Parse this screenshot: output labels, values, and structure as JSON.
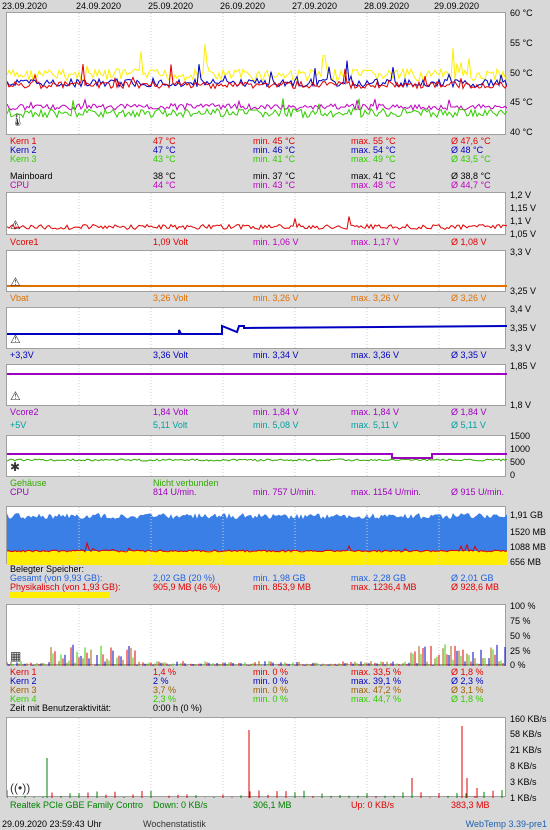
{
  "dates": [
    "23.09.2020",
    "24.09.2020",
    "25.09.2020",
    "26.09.2020",
    "27.09.2020",
    "28.09.2020",
    "29.09.2020"
  ],
  "temp": {
    "y_labels": [
      "60 °C",
      "55 °C",
      "50 °C",
      "45 °C",
      "40 °C"
    ],
    "rows": [
      {
        "name": "Kern 1",
        "cur": "47 °C",
        "min": "min. 45 °C",
        "max": "max. 55 °C",
        "avg": "Ø 47,6 °C",
        "color": "#e00000"
      },
      {
        "name": "Kern 2",
        "cur": "47 °C",
        "min": "min. 46 °C",
        "max": "max. 54 °C",
        "avg": "Ø 48 °C",
        "color": "#0000c0"
      },
      {
        "name": "Kern 3",
        "cur": "43 °C",
        "min": "min. 41 °C",
        "max": "max. 49 °C",
        "avg": "Ø 43,5 °C",
        "color": "#33cc00"
      },
      {
        "name": "Mainboard",
        "cur": "38 °C",
        "min": "min. 37 °C",
        "max": "max. 41 °C",
        "avg": "Ø 38,8 °C",
        "color": "#000000"
      },
      {
        "name": "CPU",
        "cur": "44 °C",
        "min": "min. 43 °C",
        "max": "max. 48 °C",
        "avg": "Ø 44,7 °C",
        "color": "#c000c0"
      }
    ]
  },
  "vcore": {
    "y_labels": [
      "1,2 V",
      "1,15 V",
      "1,1 V",
      "1,05 V"
    ],
    "row": {
      "name": "Vcore1",
      "cur": "1,09 Volt",
      "min": "min. 1,06 V",
      "max": "max. 1,17 V",
      "avg": "Ø 1,08 V",
      "color": "#e00000"
    }
  },
  "vbat": {
    "y_labels": [
      "3,3 V",
      "3,25 V"
    ],
    "row": {
      "name": "Vbat",
      "cur": "3,26 Volt",
      "min": "min. 3,26 V",
      "max": "max. 3,26 V",
      "avg": "Ø 3,26 V",
      "color": "#e07000"
    }
  },
  "v33": {
    "y_labels": [
      "3,4 V",
      "3,35 V",
      "3,3 V"
    ],
    "row": {
      "name": "+3,3V",
      "cur": "3,36 Volt",
      "min": "min. 3,34 V",
      "max": "max. 3,36 V",
      "avg": "Ø 3,35 V",
      "color": "#0000c0"
    }
  },
  "vcore2": {
    "y_labels": [
      "1,85 V",
      "1,8 V"
    ],
    "rows": [
      {
        "name": "Vcore2",
        "cur": "1,84 Volt",
        "min": "min. 1,84 V",
        "max": "max. 1,84 V",
        "avg": "Ø 1,84 V",
        "color": "#a000c0"
      },
      {
        "name": "+5V",
        "cur": "5,11 Volt",
        "min": "min. 5,08 V",
        "max": "max. 5,11 V",
        "avg": "Ø 5,11 V",
        "color": "#00a0a0"
      }
    ]
  },
  "fan": {
    "y_labels": [
      "1500",
      "1000",
      "500",
      "0"
    ],
    "rows": [
      {
        "name": "Gehäuse",
        "cur": "Nicht verbunden",
        "min": "",
        "max": "",
        "avg": "",
        "color": "#33aa00"
      },
      {
        "name": "CPU",
        "cur": "814 U/min.",
        "min": "min. 757 U/min.",
        "max": "max. 1154 U/min.",
        "avg": "Ø 915 U/min.",
        "color": "#a000c0"
      }
    ]
  },
  "mem": {
    "y_labels": [
      "1,91 GB",
      "1520 MB",
      "1088 MB",
      "656 MB"
    ],
    "title": "Belegter Speicher:",
    "rows": [
      {
        "name": "Gesamt (von 9,93 GB):",
        "cur": "2,02 GB (20 %)",
        "min": "min. 1,98 GB",
        "max": "max. 2,28 GB",
        "avg": "Ø 2,01 GB",
        "color": "#2060e0"
      },
      {
        "name": "Physikalisch (von 1,93 GB):",
        "cur": "905,9 MB (46 %)",
        "min": "min. 853,9 MB",
        "max": "max. 1236,4 MB",
        "avg": "Ø 928,6 MB",
        "color": "#e00000"
      }
    ]
  },
  "cpu": {
    "y_labels": [
      "100 %",
      "75 %",
      "50 %",
      "25 %",
      "0 %"
    ],
    "rows": [
      {
        "name": "Kern 1",
        "cur": "1,4 %",
        "min": "min. 0 %",
        "max": "max. 33,5 %",
        "avg": "Ø 1,8 %",
        "color": "#e00000"
      },
      {
        "name": "Kern 2",
        "cur": "2 %",
        "min": "min. 0 %",
        "max": "max. 39,1 %",
        "avg": "Ø 2,3 %",
        "color": "#0000c0"
      },
      {
        "name": "Kern 3",
        "cur": "3,7 %",
        "min": "min. 0 %",
        "max": "max. 47,2 %",
        "avg": "Ø 3,1 %",
        "color": "#a06000"
      },
      {
        "name": "Kern 4",
        "cur": "2,3 %",
        "min": "min. 0 %",
        "max": "max. 44,7 %",
        "avg": "Ø 1,8 %",
        "color": "#33cc00"
      }
    ],
    "usertime_label": "Zeit mit Benutzeraktivität:",
    "usertime_value": "0:00 h (0 %)"
  },
  "net": {
    "y_labels": [
      "160 KB/s",
      "58 KB/s",
      "21 KB/s",
      "8 KB/s",
      "3 KB/s",
      "1 KB/s"
    ],
    "name": "Realtek PCIe GBE Family Contro",
    "down": "Down: 0 KB/s",
    "down_total": "306,1 MB",
    "up": "Up: 0 KB/s",
    "up_total": "383,3 MB"
  },
  "status": {
    "datetime": "29.09.2020 23:59:43 Uhr",
    "mode": "Wochenstatistik",
    "app": "WebTemp 3.39-pre1"
  },
  "colors": {
    "panel_bg": "#ffffff",
    "page_bg": "#d8d8d8",
    "mem_blue": "#3a7fe6",
    "mem_yellow": "#ffee00",
    "temp_yellow": "#ffee00"
  },
  "icons": [
    "thermometer-icon",
    "voltage-warning-icon",
    "fan-icon",
    "chip-icon",
    "network-icon"
  ]
}
